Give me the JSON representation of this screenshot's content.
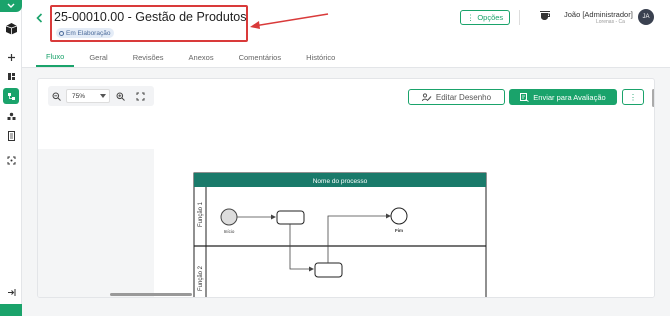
{
  "header": {
    "back_icon": "chevron-left-icon",
    "title": "25-00010.00 - Gestão de Produtos",
    "status_badge": "Em Elaboração",
    "options_label": "Opções",
    "user_name": "João [Administrador]",
    "user_sub": "Lorenas - Ca"
  },
  "tabs": [
    {
      "label": "Fluxo",
      "active": true
    },
    {
      "label": "Geral"
    },
    {
      "label": "Revisões"
    },
    {
      "label": "Anexos"
    },
    {
      "label": "Comentários"
    },
    {
      "label": "Histórico"
    }
  ],
  "toolbar": {
    "zoom_value": "75%",
    "edit_label": "Editar Desenho",
    "send_label": "Enviar para Avaliação"
  },
  "diagram": {
    "pool_title": "Nome do processo",
    "lane1_label": "Função 1",
    "lane2_label": "Função 2",
    "start_label": "Início",
    "end_label": "Fim"
  },
  "colors": {
    "accent": "#1aa36b",
    "highlight": "#d93a3a",
    "pool_header": "#1a7a6a"
  }
}
